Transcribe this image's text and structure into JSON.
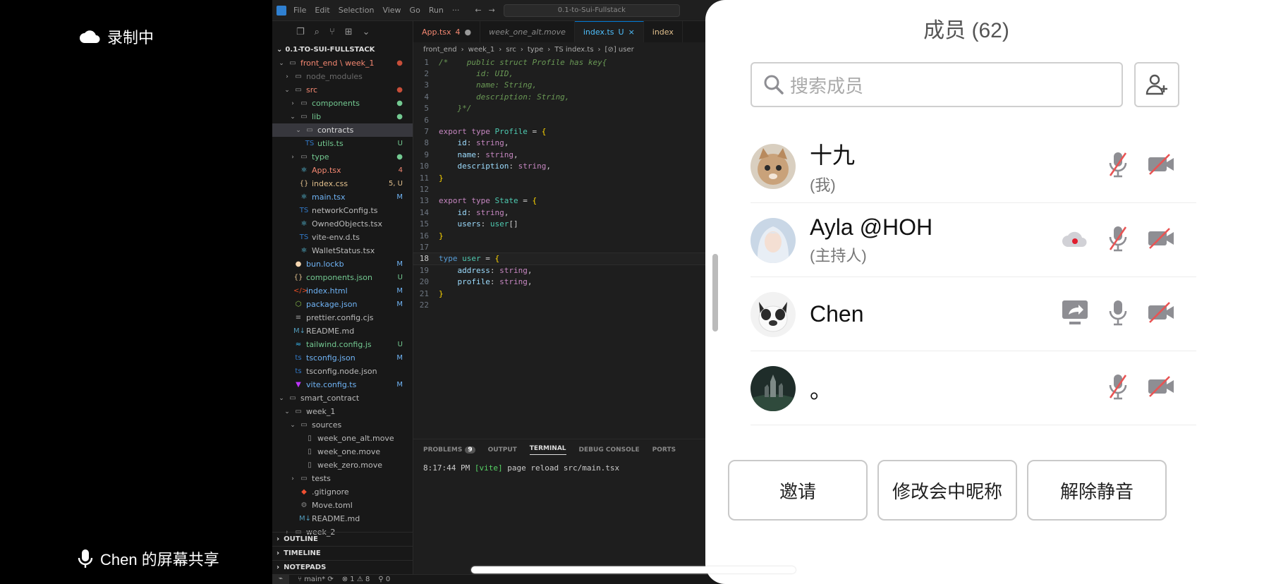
{
  "overlay": {
    "recording_label": "录制中",
    "share_label": "Chen 的屏幕共享"
  },
  "vscode": {
    "menu": [
      "File",
      "Edit",
      "Selection",
      "View",
      "Go",
      "Run",
      "···"
    ],
    "command_center": "0.1-to-Sui-Fullstack",
    "explorer_title": "0.1-TO-SUI-FULLSTACK",
    "tree": [
      {
        "label": "front_end \\ week_1",
        "color": "#f48771",
        "depth": 0,
        "chev": "v",
        "icon": "folder",
        "status": "●",
        "status_color": "#c74e39"
      },
      {
        "label": "node_modules",
        "color": "#6b6b6b",
        "depth": 1,
        "chev": ">",
        "icon": "folder",
        "status": "",
        "status_color": ""
      },
      {
        "label": "src",
        "color": "#f48771",
        "depth": 1,
        "chev": "v",
        "icon": "folder",
        "status": "●",
        "status_color": "#c74e39"
      },
      {
        "label": "components",
        "color": "#73c991",
        "depth": 2,
        "chev": ">",
        "icon": "folder",
        "status": "●",
        "status_color": "#73c991"
      },
      {
        "label": "lib",
        "color": "#73c991",
        "depth": 2,
        "chev": "v",
        "icon": "folder",
        "status": "●",
        "status_color": "#73c991"
      },
      {
        "label": "contracts",
        "color": "#dddddd",
        "depth": 3,
        "chev": "v",
        "icon": "folder",
        "status": "",
        "status_color": "",
        "selected": true
      },
      {
        "label": "utils.ts",
        "color": "#73c991",
        "depth": 3,
        "chev": "",
        "icon": "TS",
        "status": "U",
        "status_color": "#73c991"
      },
      {
        "label": "type",
        "color": "#73c991",
        "depth": 2,
        "chev": ">",
        "icon": "folder",
        "status": "●",
        "status_color": "#73c991"
      },
      {
        "label": "App.tsx",
        "color": "#f48771",
        "depth": 2,
        "chev": "",
        "icon": "react",
        "status": "4",
        "status_color": "#f48771"
      },
      {
        "label": "index.css",
        "color": "#e2c08d",
        "depth": 2,
        "chev": "",
        "icon": "{}",
        "status": "5, U",
        "status_color": "#e2c08d"
      },
      {
        "label": "main.tsx",
        "color": "#6fb3f5",
        "depth": 2,
        "chev": "",
        "icon": "react",
        "status": "M",
        "status_color": "#6fb3f5"
      },
      {
        "label": "networkConfig.ts",
        "color": "#bbbbbb",
        "depth": 2,
        "chev": "",
        "icon": "TS",
        "status": "",
        "status_color": ""
      },
      {
        "label": "OwnedObjects.tsx",
        "color": "#bbbbbb",
        "depth": 2,
        "chev": "",
        "icon": "react",
        "status": "",
        "status_color": ""
      },
      {
        "label": "vite-env.d.ts",
        "color": "#bbbbbb",
        "depth": 2,
        "chev": "",
        "icon": "TS",
        "status": "",
        "status_color": ""
      },
      {
        "label": "WalletStatus.tsx",
        "color": "#bbbbbb",
        "depth": 2,
        "chev": "",
        "icon": "react",
        "status": "",
        "status_color": ""
      },
      {
        "label": "bun.lockb",
        "color": "#6fb3f5",
        "depth": 1,
        "chev": "",
        "icon": "bun",
        "status": "M",
        "status_color": "#6fb3f5"
      },
      {
        "label": "components.json",
        "color": "#73c991",
        "depth": 1,
        "chev": "",
        "icon": "{}",
        "status": "U",
        "status_color": "#73c991"
      },
      {
        "label": "index.html",
        "color": "#6fb3f5",
        "depth": 1,
        "chev": "",
        "icon": "<>",
        "status": "M",
        "status_color": "#6fb3f5"
      },
      {
        "label": "package.json",
        "color": "#6fb3f5",
        "depth": 1,
        "chev": "",
        "icon": "pkg",
        "status": "M",
        "status_color": "#6fb3f5"
      },
      {
        "label": "prettier.config.cjs",
        "color": "#bbbbbb",
        "depth": 1,
        "chev": "",
        "icon": "cfg",
        "status": "",
        "status_color": ""
      },
      {
        "label": "README.md",
        "color": "#bbbbbb",
        "depth": 1,
        "chev": "",
        "icon": "md",
        "status": "",
        "status_color": ""
      },
      {
        "label": "tailwind.config.js",
        "color": "#73c991",
        "depth": 1,
        "chev": "",
        "icon": "tw",
        "status": "U",
        "status_color": "#73c991"
      },
      {
        "label": "tsconfig.json",
        "color": "#6fb3f5",
        "depth": 1,
        "chev": "",
        "icon": "ts",
        "status": "M",
        "status_color": "#6fb3f5"
      },
      {
        "label": "tsconfig.node.json",
        "color": "#bbbbbb",
        "depth": 1,
        "chev": "",
        "icon": "ts",
        "status": "",
        "status_color": ""
      },
      {
        "label": "vite.config.ts",
        "color": "#6fb3f5",
        "depth": 1,
        "chev": "",
        "icon": "vite",
        "status": "M",
        "status_color": "#6fb3f5"
      },
      {
        "label": "smart_contract",
        "color": "#bbbbbb",
        "depth": 0,
        "chev": "v",
        "icon": "folder",
        "status": "",
        "status_color": ""
      },
      {
        "label": "week_1",
        "color": "#bbbbbb",
        "depth": 1,
        "chev": "v",
        "icon": "folder",
        "status": "",
        "status_color": ""
      },
      {
        "label": "sources",
        "color": "#bbbbbb",
        "depth": 2,
        "chev": "v",
        "icon": "folder",
        "status": "",
        "status_color": ""
      },
      {
        "label": "week_one_alt.move",
        "color": "#bbbbbb",
        "depth": 3,
        "chev": "",
        "icon": "file",
        "status": "",
        "status_color": ""
      },
      {
        "label": "week_one.move",
        "color": "#bbbbbb",
        "depth": 3,
        "chev": "",
        "icon": "file",
        "status": "",
        "status_color": ""
      },
      {
        "label": "week_zero.move",
        "color": "#bbbbbb",
        "depth": 3,
        "chev": "",
        "icon": "file",
        "status": "",
        "status_color": ""
      },
      {
        "label": "tests",
        "color": "#bbbbbb",
        "depth": 2,
        "chev": ">",
        "icon": "folder",
        "status": "",
        "status_color": ""
      },
      {
        "label": ".gitignore",
        "color": "#bbbbbb",
        "depth": 2,
        "chev": "",
        "icon": "git",
        "status": "",
        "status_color": ""
      },
      {
        "label": "Move.toml",
        "color": "#bbbbbb",
        "depth": 2,
        "chev": "",
        "icon": "gear",
        "status": "",
        "status_color": ""
      },
      {
        "label": "README.md",
        "color": "#bbbbbb",
        "depth": 2,
        "chev": "",
        "icon": "md",
        "status": "",
        "status_color": ""
      },
      {
        "label": "week_2",
        "color": "#bbbbbb",
        "depth": 1,
        "chev": ">",
        "icon": "folder",
        "status": "",
        "status_color": ""
      }
    ],
    "panels": [
      "OUTLINE",
      "TIMELINE",
      "NOTEPADS"
    ],
    "tabs": [
      {
        "label": "App.tsx",
        "badge": "4",
        "color": "#f48771",
        "active": false
      },
      {
        "label": "week_one_alt.move",
        "badge": "",
        "color": "#888888",
        "active": false
      },
      {
        "label": "index.ts",
        "badge": "U",
        "color": "#4fc1ff",
        "active": true
      },
      {
        "label": "index",
        "badge": "",
        "color": "#e2c08d",
        "active": false
      }
    ],
    "breadcrumbs": [
      "front_end",
      "week_1",
      "src",
      "type",
      "TS index.ts",
      "[⊘] user"
    ],
    "code": [
      [
        {
          "t": "/*    public struct Profile has key{",
          "c": "cm"
        }
      ],
      [
        {
          "t": "        id: UID,",
          "c": "cm"
        }
      ],
      [
        {
          "t": "        name: String,",
          "c": "cm"
        }
      ],
      [
        {
          "t": "        description: String,",
          "c": "cm"
        }
      ],
      [
        {
          "t": "    }*/",
          "c": "cm"
        }
      ],
      [],
      [
        {
          "t": "export ",
          "c": "kw"
        },
        {
          "t": "type ",
          "c": "kw"
        },
        {
          "t": "Profile",
          "c": "tp"
        },
        {
          "t": " = ",
          "c": "pl"
        },
        {
          "t": "{",
          "c": "br"
        }
      ],
      [
        {
          "t": "    id",
          "c": "id"
        },
        {
          "t": ": ",
          "c": "pl"
        },
        {
          "t": "string",
          "c": "kw"
        },
        {
          "t": ",",
          "c": "pl"
        }
      ],
      [
        {
          "t": "    name",
          "c": "id"
        },
        {
          "t": ": ",
          "c": "pl"
        },
        {
          "t": "string",
          "c": "kw"
        },
        {
          "t": ",",
          "c": "pl"
        }
      ],
      [
        {
          "t": "    description",
          "c": "id"
        },
        {
          "t": ": ",
          "c": "pl"
        },
        {
          "t": "string",
          "c": "kw"
        },
        {
          "t": ",",
          "c": "pl"
        }
      ],
      [
        {
          "t": "}",
          "c": "br"
        }
      ],
      [],
      [
        {
          "t": "export ",
          "c": "kw"
        },
        {
          "t": "type ",
          "c": "kw"
        },
        {
          "t": "State",
          "c": "tp"
        },
        {
          "t": " = ",
          "c": "pl"
        },
        {
          "t": "{",
          "c": "br"
        }
      ],
      [
        {
          "t": "    id",
          "c": "id"
        },
        {
          "t": ": ",
          "c": "pl"
        },
        {
          "t": "string",
          "c": "kw"
        },
        {
          "t": ",",
          "c": "pl"
        }
      ],
      [
        {
          "t": "    users",
          "c": "id"
        },
        {
          "t": ": ",
          "c": "pl"
        },
        {
          "t": "user",
          "c": "tp"
        },
        {
          "t": "[]",
          "c": "pl"
        }
      ],
      [
        {
          "t": "}",
          "c": "br"
        }
      ],
      [],
      [
        {
          "t": "type ",
          "c": "ty"
        },
        {
          "t": "user",
          "c": "tp"
        },
        {
          "t": " = ",
          "c": "pl"
        },
        {
          "t": "{",
          "c": "br"
        }
      ],
      [
        {
          "t": "    address",
          "c": "id"
        },
        {
          "t": ": ",
          "c": "pl"
        },
        {
          "t": "string",
          "c": "kw"
        },
        {
          "t": ",",
          "c": "pl"
        }
      ],
      [
        {
          "t": "    profile",
          "c": "id"
        },
        {
          "t": ": ",
          "c": "pl"
        },
        {
          "t": "string",
          "c": "kw"
        },
        {
          "t": ",",
          "c": "pl"
        }
      ],
      [
        {
          "t": "}",
          "c": "br"
        }
      ],
      []
    ],
    "current_line": 18,
    "terminal_tabs": [
      {
        "label": "PROBLEMS",
        "badge": "9",
        "active": false
      },
      {
        "label": "OUTPUT",
        "badge": "",
        "active": false
      },
      {
        "label": "TERMINAL",
        "badge": "",
        "active": true
      },
      {
        "label": "DEBUG CONSOLE",
        "badge": "",
        "active": false
      },
      {
        "label": "PORTS",
        "badge": "",
        "active": false
      }
    ],
    "terminal_time": "8:17:44 PM",
    "terminal_tag": "[vite]",
    "terminal_msg": "page reload src/main.tsx",
    "status_branch": "main*",
    "status_errors": "⊗ 1 ⚠ 8",
    "status_ports": "⚲ 0"
  },
  "meeting": {
    "title": "成员 (62)",
    "search_placeholder": "搜索成员",
    "members": [
      {
        "name": "十九",
        "role": "(我)",
        "mic_muted": true,
        "cam_off": true,
        "recording": false,
        "sharing": false,
        "avatar": "cat"
      },
      {
        "name": "Ayla @HOH",
        "role": "(主持人)",
        "mic_muted": true,
        "cam_off": true,
        "recording": true,
        "sharing": false,
        "avatar": "girl"
      },
      {
        "name": "Chen",
        "role": "",
        "mic_muted": false,
        "cam_off": true,
        "recording": false,
        "sharing": true,
        "avatar": "dog"
      },
      {
        "name": "。",
        "role": "",
        "mic_muted": true,
        "cam_off": true,
        "recording": false,
        "sharing": false,
        "avatar": "castle"
      }
    ],
    "buttons": {
      "invite": "邀请",
      "rename": "修改会中昵称",
      "unmute": "解除静音"
    }
  },
  "colors": {
    "muted_red": "#e85454",
    "icon_gray": "#8e8e93"
  }
}
